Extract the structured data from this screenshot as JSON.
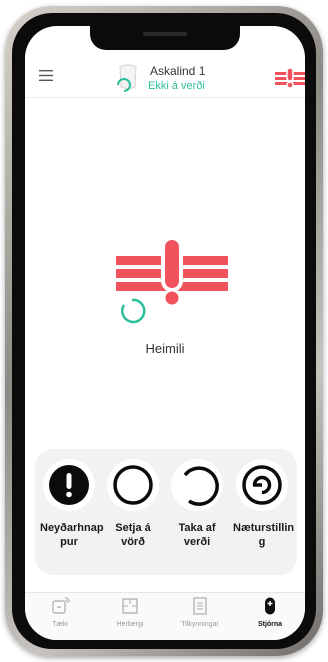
{
  "header": {
    "device_name": "Askalind 1",
    "device_status": "Ekki á verði",
    "menu_icon": "hamburger-menu-icon",
    "alarm_icon": "alarm-icon"
  },
  "main": {
    "mode_label": "Heimili",
    "alarm_color": "#f0535b",
    "accent_color": "#2bbf9b"
  },
  "actions": [
    {
      "label": "Neyðarhnappur",
      "line1": "Neyðarhnap",
      "line2": "pur",
      "icon": "emergency-icon"
    },
    {
      "label": "Setja á vörð",
      "line1": "Setja á vörð",
      "line2": "",
      "icon": "arm-icon"
    },
    {
      "label": "Taka af verði",
      "line1": "Taka af",
      "line2": "verði",
      "icon": "disarm-icon"
    },
    {
      "label": "Næturstilling",
      "line1": "Næturstillin",
      "line2": "g",
      "icon": "night-mode-icon"
    }
  ],
  "tabs": [
    {
      "label": "Tæki",
      "active": false
    },
    {
      "label": "Herbergi",
      "active": false
    },
    {
      "label": "Tilkynningar",
      "active": false
    },
    {
      "label": "Stjórna",
      "active": true
    }
  ]
}
